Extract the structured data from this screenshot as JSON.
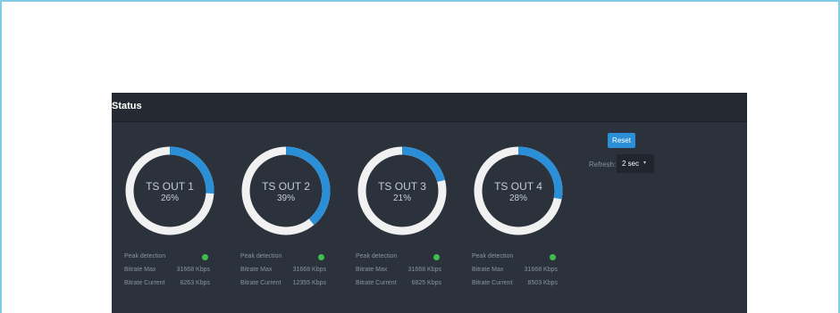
{
  "panel": {
    "title": "Status"
  },
  "controls": {
    "reset_label": "Reset",
    "refresh_label": "Refresh:",
    "refresh_value": "2 sec"
  },
  "colors": {
    "arc": "#2a8fd6",
    "track": "#f1f1f1",
    "led_ok": "#3fbf4a"
  },
  "outputs": [
    {
      "name": "TS OUT 1",
      "percent_label": "26%",
      "percent": 26,
      "peak_label": "Peak detection",
      "peak_status": "ok",
      "bitrate_max_label": "Bitrate Max",
      "bitrate_max": "31668 Kbps",
      "bitrate_current_label": "Bitrate Current",
      "bitrate_current": "8263 Kbps"
    },
    {
      "name": "TS OUT 2",
      "percent_label": "39%",
      "percent": 39,
      "peak_label": "Peak detection",
      "peak_status": "ok",
      "bitrate_max_label": "Bitrate Max",
      "bitrate_max": "31668 Kbps",
      "bitrate_current_label": "Bitrate Current",
      "bitrate_current": "12355 Kbps"
    },
    {
      "name": "TS OUT 3",
      "percent_label": "21%",
      "percent": 21,
      "peak_label": "Peak detection",
      "peak_status": "ok",
      "bitrate_max_label": "Bitrate Max",
      "bitrate_max": "31668 Kbps",
      "bitrate_current_label": "Bitrate Current",
      "bitrate_current": "6825 Kbps"
    },
    {
      "name": "TS OUT 4",
      "percent_label": "28%",
      "percent": 28,
      "peak_label": "Peak detection",
      "peak_status": "ok",
      "bitrate_max_label": "Bitrate Max",
      "bitrate_max": "31668 Kbps",
      "bitrate_current_label": "Bitrate Current",
      "bitrate_current": "8503 Kbps"
    }
  ]
}
